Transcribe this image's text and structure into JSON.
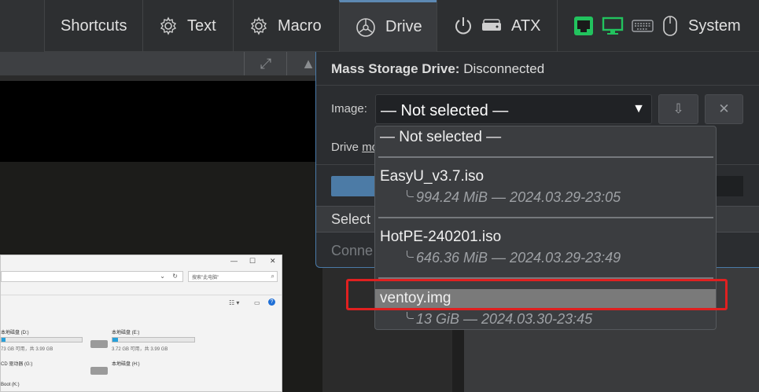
{
  "menu": {
    "shortcuts": "Shortcuts",
    "text": "Text",
    "macro": "Macro",
    "drive": "Drive",
    "atx": "ATX",
    "system": "System"
  },
  "panel": {
    "title_bold": "Mass Storage Drive:",
    "title_status": "Disconnected",
    "image_label": "Image:",
    "selected_value": "— Not selected —",
    "drive_mode_label": "Drive",
    "drive_mode_link": "mo",
    "section_label": "Select",
    "connect_label": "Conne"
  },
  "dropdown": {
    "options": [
      {
        "name": "— Not selected —",
        "meta": ""
      },
      {
        "name": "EasyU_v3.7.iso",
        "meta": "994.24 MiB — 2024.03.29-23:05"
      },
      {
        "name": "HotPE-240201.iso",
        "meta": "646.36 MiB — 2024.03.29-23:49"
      },
      {
        "name": "ventoy.img",
        "meta": "13 GiB — 2024.03.30-23:45"
      }
    ],
    "highlighted": "ventoy.img"
  },
  "explorer": {
    "search_placeholder": "搜索\"此电脑\"",
    "drives": [
      {
        "name": "本地磁盘 (D:)",
        "info": "73 GB 可用，共 3.99 GB",
        "fill": 0.05
      },
      {
        "name": "本地磁盘 (E:)",
        "info": "3.72 GB 可用，共 3.99 GB",
        "fill": 0.07
      },
      {
        "name": "CD 驱动器 (G:)",
        "info": "",
        "fill": 0
      },
      {
        "name": "本地磁盘 (H:)",
        "info": "",
        "fill": 0
      },
      {
        "name": "Boot (K:)",
        "info": "",
        "fill": 0
      }
    ]
  },
  "colors": {
    "accent": "#5d89b3",
    "highlight_red": "#e02020",
    "status_green": "#22c35e"
  },
  "icons": [
    "gear-icon",
    "power-icon",
    "hdd-icon",
    "ethernet-icon",
    "monitor-icon",
    "keyboard-icon",
    "mouse-icon",
    "download-icon",
    "close-icon",
    "fullscreen-icon"
  ]
}
